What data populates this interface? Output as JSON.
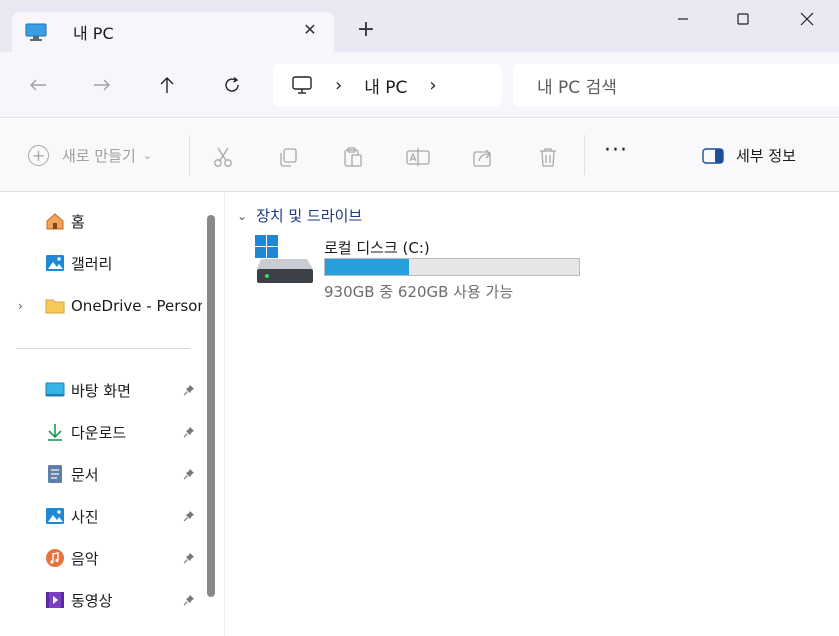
{
  "tab": {
    "title": "내 PC",
    "icon": "monitor-icon"
  },
  "address": {
    "crumb": "내 PC",
    "search_placeholder": "내 PC 검색"
  },
  "toolbar": {
    "new_label": "새로 만들기",
    "details_label": "세부 정보",
    "more_label": "···"
  },
  "sidebar": {
    "items": [
      {
        "label": "홈",
        "icon": "home-icon"
      },
      {
        "label": "갤러리",
        "icon": "gallery-icon"
      },
      {
        "label": "OneDrive - Person",
        "icon": "folder-icon"
      },
      {
        "label": "바탕 화면",
        "icon": "desktop-icon"
      },
      {
        "label": "다운로드",
        "icon": "download-icon"
      },
      {
        "label": "문서",
        "icon": "document-icon"
      },
      {
        "label": "사진",
        "icon": "pictures-icon"
      },
      {
        "label": "음악",
        "icon": "music-icon"
      },
      {
        "label": "동영상",
        "icon": "video-icon"
      }
    ]
  },
  "main": {
    "group_header": "장치 및 드라이브",
    "drive": {
      "name": "로컬 디스크 (C:)",
      "usage_text": "930GB 중 620GB 사용 가능",
      "used_fraction": 0.33
    }
  },
  "colors": {
    "accent": "#26a0da",
    "titlebar": "#e8e9f3",
    "group_header": "#1b3a8a"
  }
}
